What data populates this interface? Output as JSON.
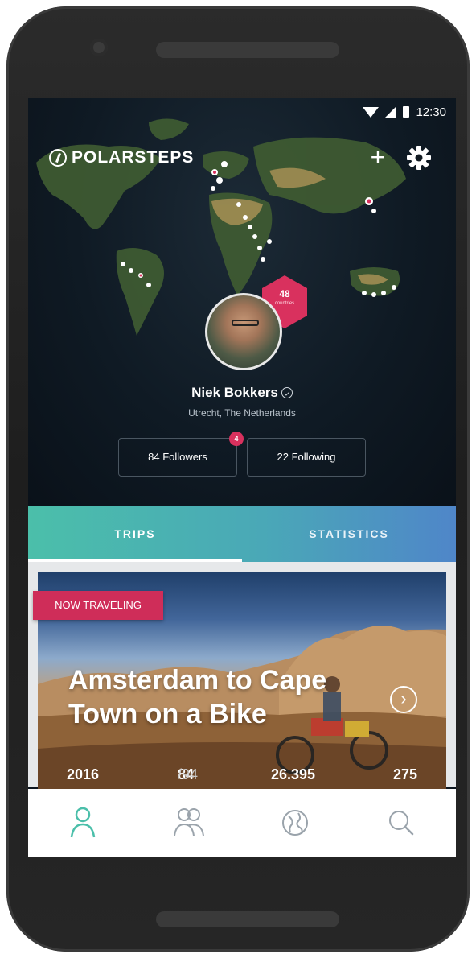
{
  "status_bar": {
    "time": "12:30"
  },
  "header": {
    "logo_text": "POLARSTEPS",
    "add_symbol": "+",
    "icons": {
      "logo": "polarsteps-logo-icon",
      "add": "plus-icon",
      "settings": "gear-icon"
    }
  },
  "profile": {
    "name": "Niek Bokkers",
    "location": "Utrecht, The Netherlands",
    "badge_count": "48",
    "badge_label": "countries",
    "followers_label": "84 Followers",
    "following_label": "22 Following",
    "followers_notification": "4"
  },
  "tabs": [
    {
      "label": "TRIPS",
      "active": true
    },
    {
      "label": "STATISTICS",
      "active": false
    }
  ],
  "trip": {
    "tag": "NOW TRAVELING",
    "title": "Amsterdam to Cape Town on a Bike",
    "arrow_symbol": "›",
    "stats": {
      "year": "2016",
      "days": "84",
      "days_total": "/94",
      "distance": "26.395",
      "steps": "275"
    }
  },
  "bottom_nav": [
    {
      "icon": "profile-icon",
      "active": true
    },
    {
      "icon": "friends-icon",
      "active": false
    },
    {
      "icon": "globe-icon",
      "active": false
    },
    {
      "icon": "search-icon",
      "active": false
    }
  ],
  "colors": {
    "accent": "#4bbfaa",
    "tag": "#cf2d59",
    "badge": "#d9315e",
    "tab_end": "#4f86c9"
  }
}
